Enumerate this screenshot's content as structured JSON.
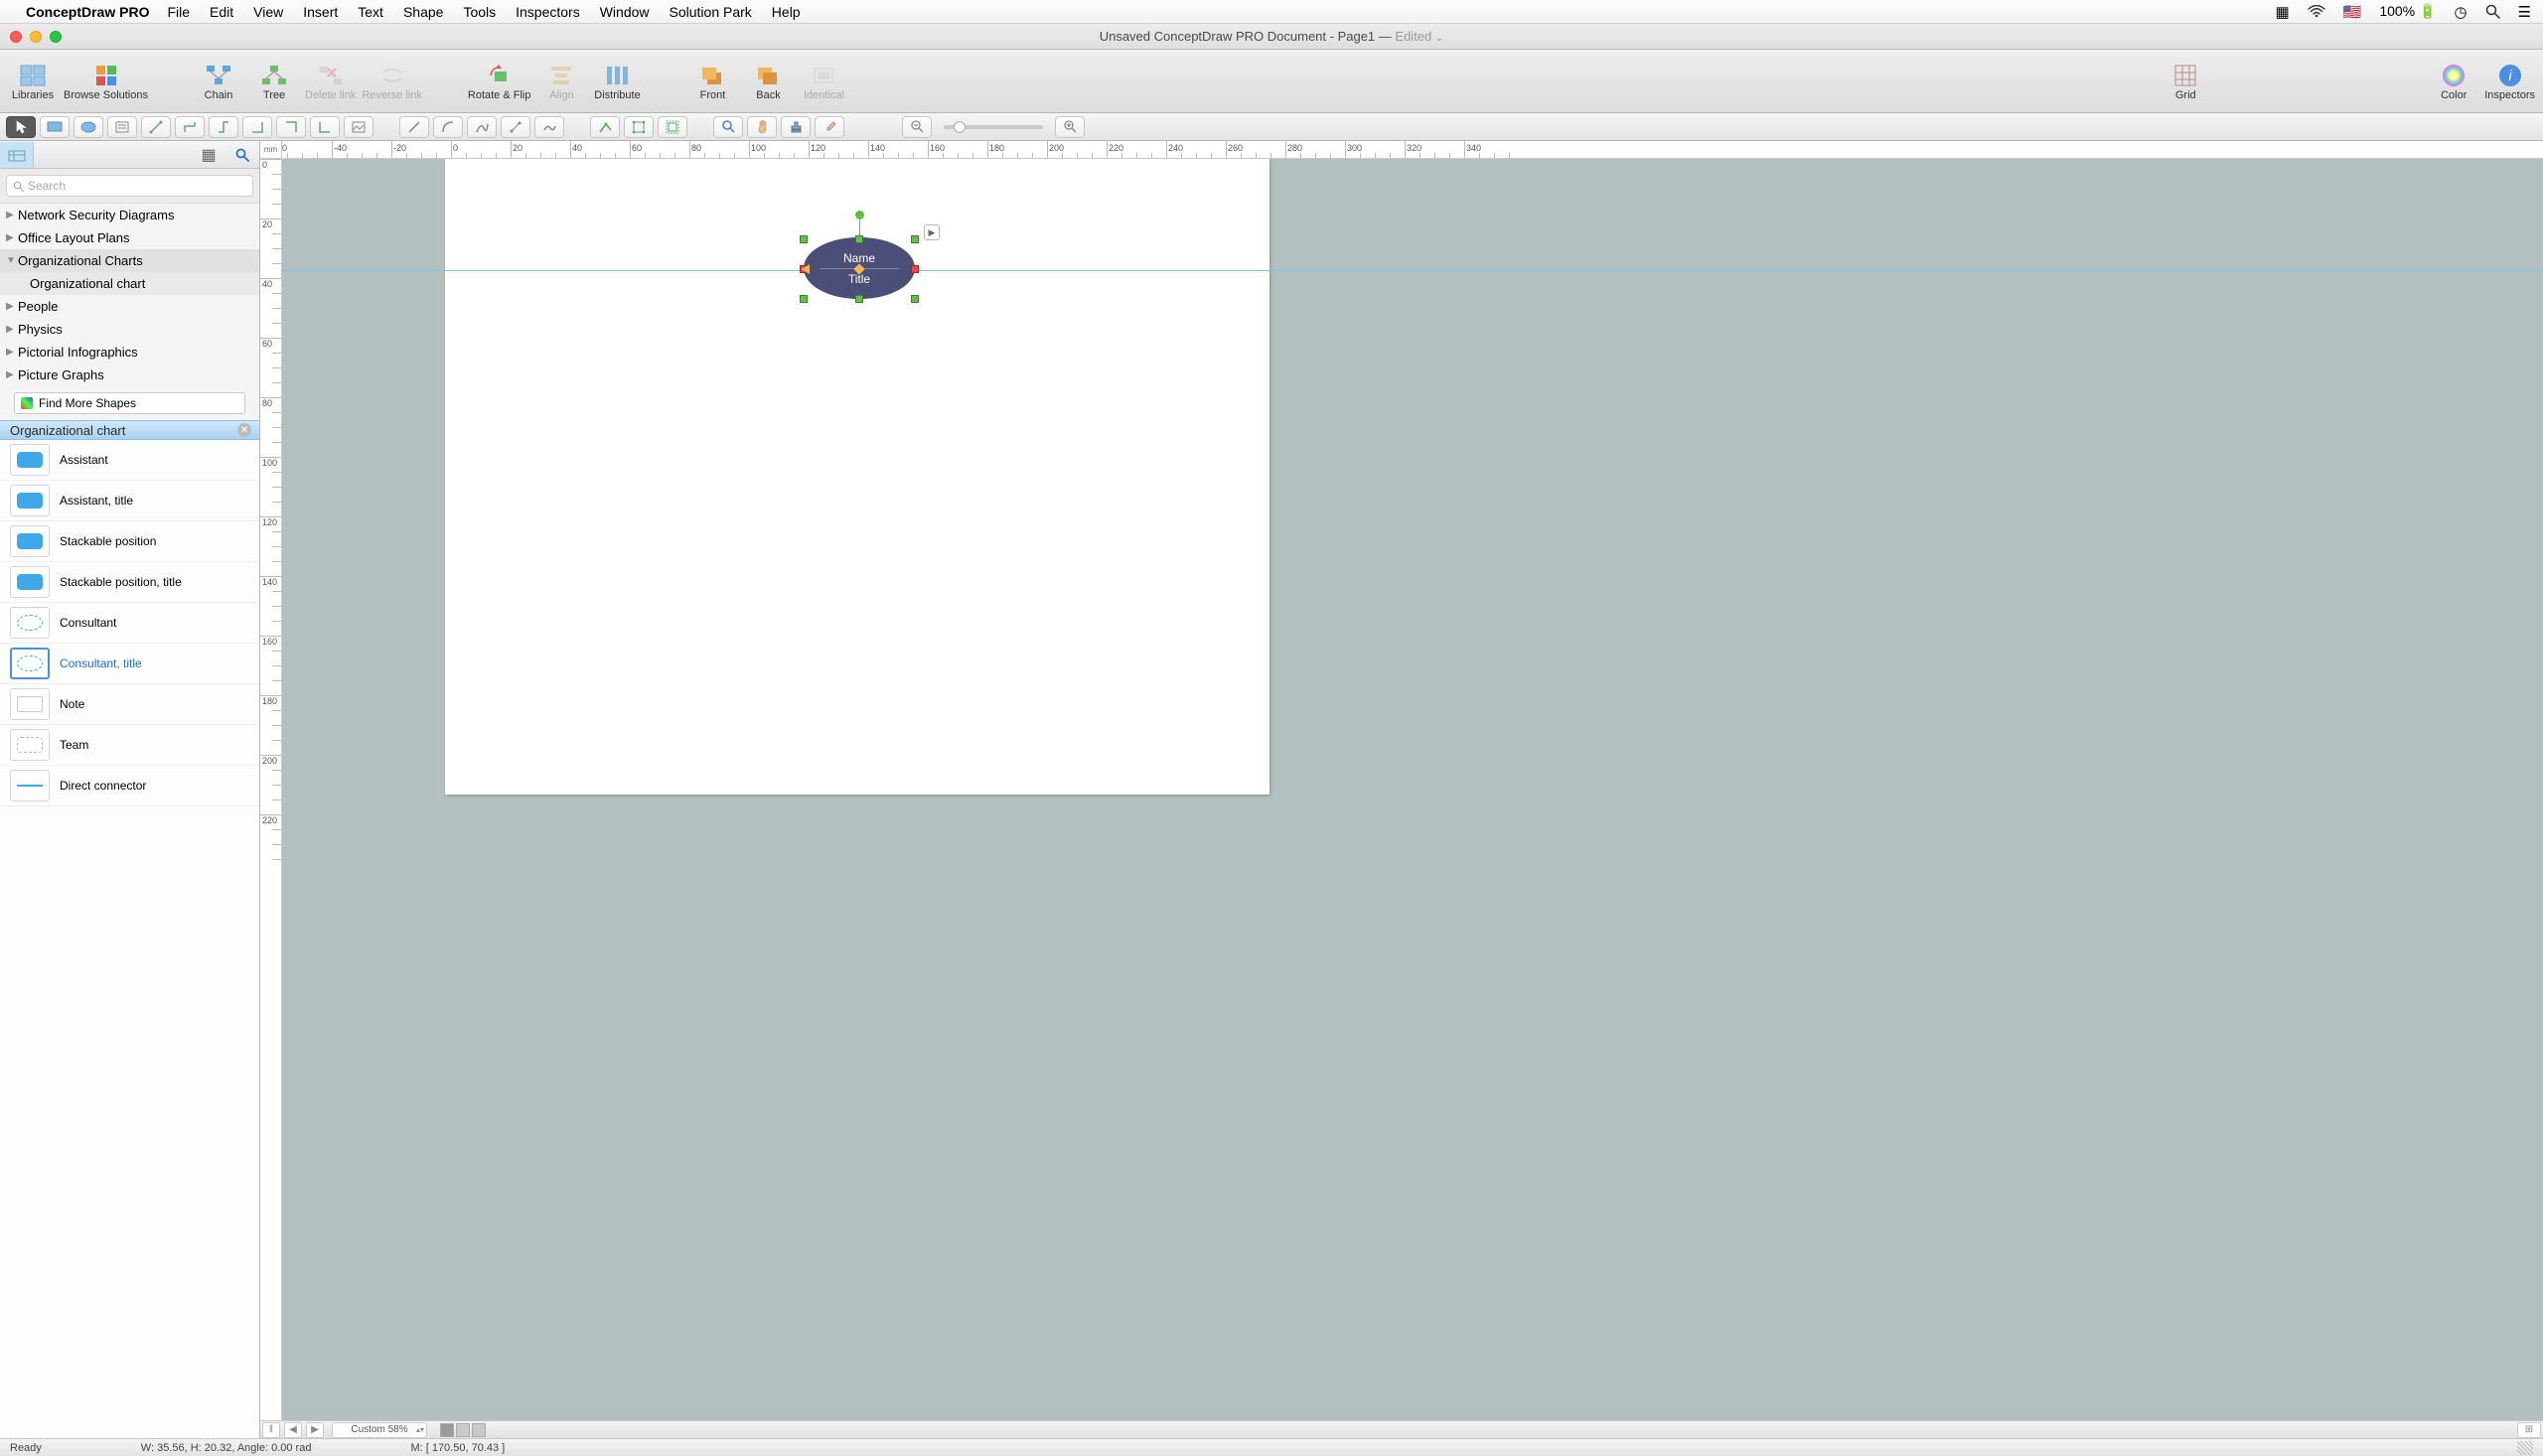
{
  "menubar": {
    "app_name": "ConceptDraw PRO",
    "items": [
      "File",
      "Edit",
      "View",
      "Insert",
      "Text",
      "Shape",
      "Tools",
      "Inspectors",
      "Window",
      "Solution Park",
      "Help"
    ],
    "battery": "100%"
  },
  "titlebar": {
    "document": "Unsaved ConceptDraw PRO Document - Page1",
    "edited": "Edited"
  },
  "toolbar": {
    "libraries": "Libraries",
    "browse": "Browse Solutions",
    "chain": "Chain",
    "tree": "Tree",
    "delete_link": "Delete link",
    "reverse_link": "Reverse link",
    "rotate_flip": "Rotate & Flip",
    "align": "Align",
    "distribute": "Distribute",
    "front": "Front",
    "back": "Back",
    "identical": "Identical",
    "grid": "Grid",
    "color": "Color",
    "inspectors": "Inspectors"
  },
  "sidebar": {
    "search_placeholder": "Search",
    "tree_items": [
      {
        "label": "Network Security Diagrams",
        "exp": false
      },
      {
        "label": "Office Layout Plans",
        "exp": false
      },
      {
        "label": "Organizational Charts",
        "exp": true
      },
      {
        "label": "Organizational chart",
        "child": true
      },
      {
        "label": "People",
        "exp": false
      },
      {
        "label": "Physics",
        "exp": false
      },
      {
        "label": "Pictorial Infographics",
        "exp": false
      },
      {
        "label": "Picture Graphs",
        "exp": false
      }
    ],
    "find_more": "Find More Shapes",
    "active_library": "Organizational chart",
    "shapes": [
      {
        "label": "Assistant",
        "kind": "rect"
      },
      {
        "label": "Assistant, title",
        "kind": "rect"
      },
      {
        "label": "Stackable position",
        "kind": "rect"
      },
      {
        "label": "Stackable position, title",
        "kind": "rect"
      },
      {
        "label": "Consultant",
        "kind": "ell"
      },
      {
        "label": "Consultant, title",
        "kind": "ell",
        "selected": true
      },
      {
        "label": "Note",
        "kind": "note"
      },
      {
        "label": "Team",
        "kind": "team"
      },
      {
        "label": "Direct connector",
        "kind": "line"
      }
    ]
  },
  "ruler_unit": "mm",
  "canvas_shape": {
    "name": "Name",
    "title": "Title"
  },
  "footer": {
    "zoom_label": "Custom 58%",
    "ready": "Ready",
    "measure": "W: 35.56,  H: 20.32,  Angle: 0.00 rad",
    "mouse": "M: [ 170.50, 70.43 ]"
  }
}
